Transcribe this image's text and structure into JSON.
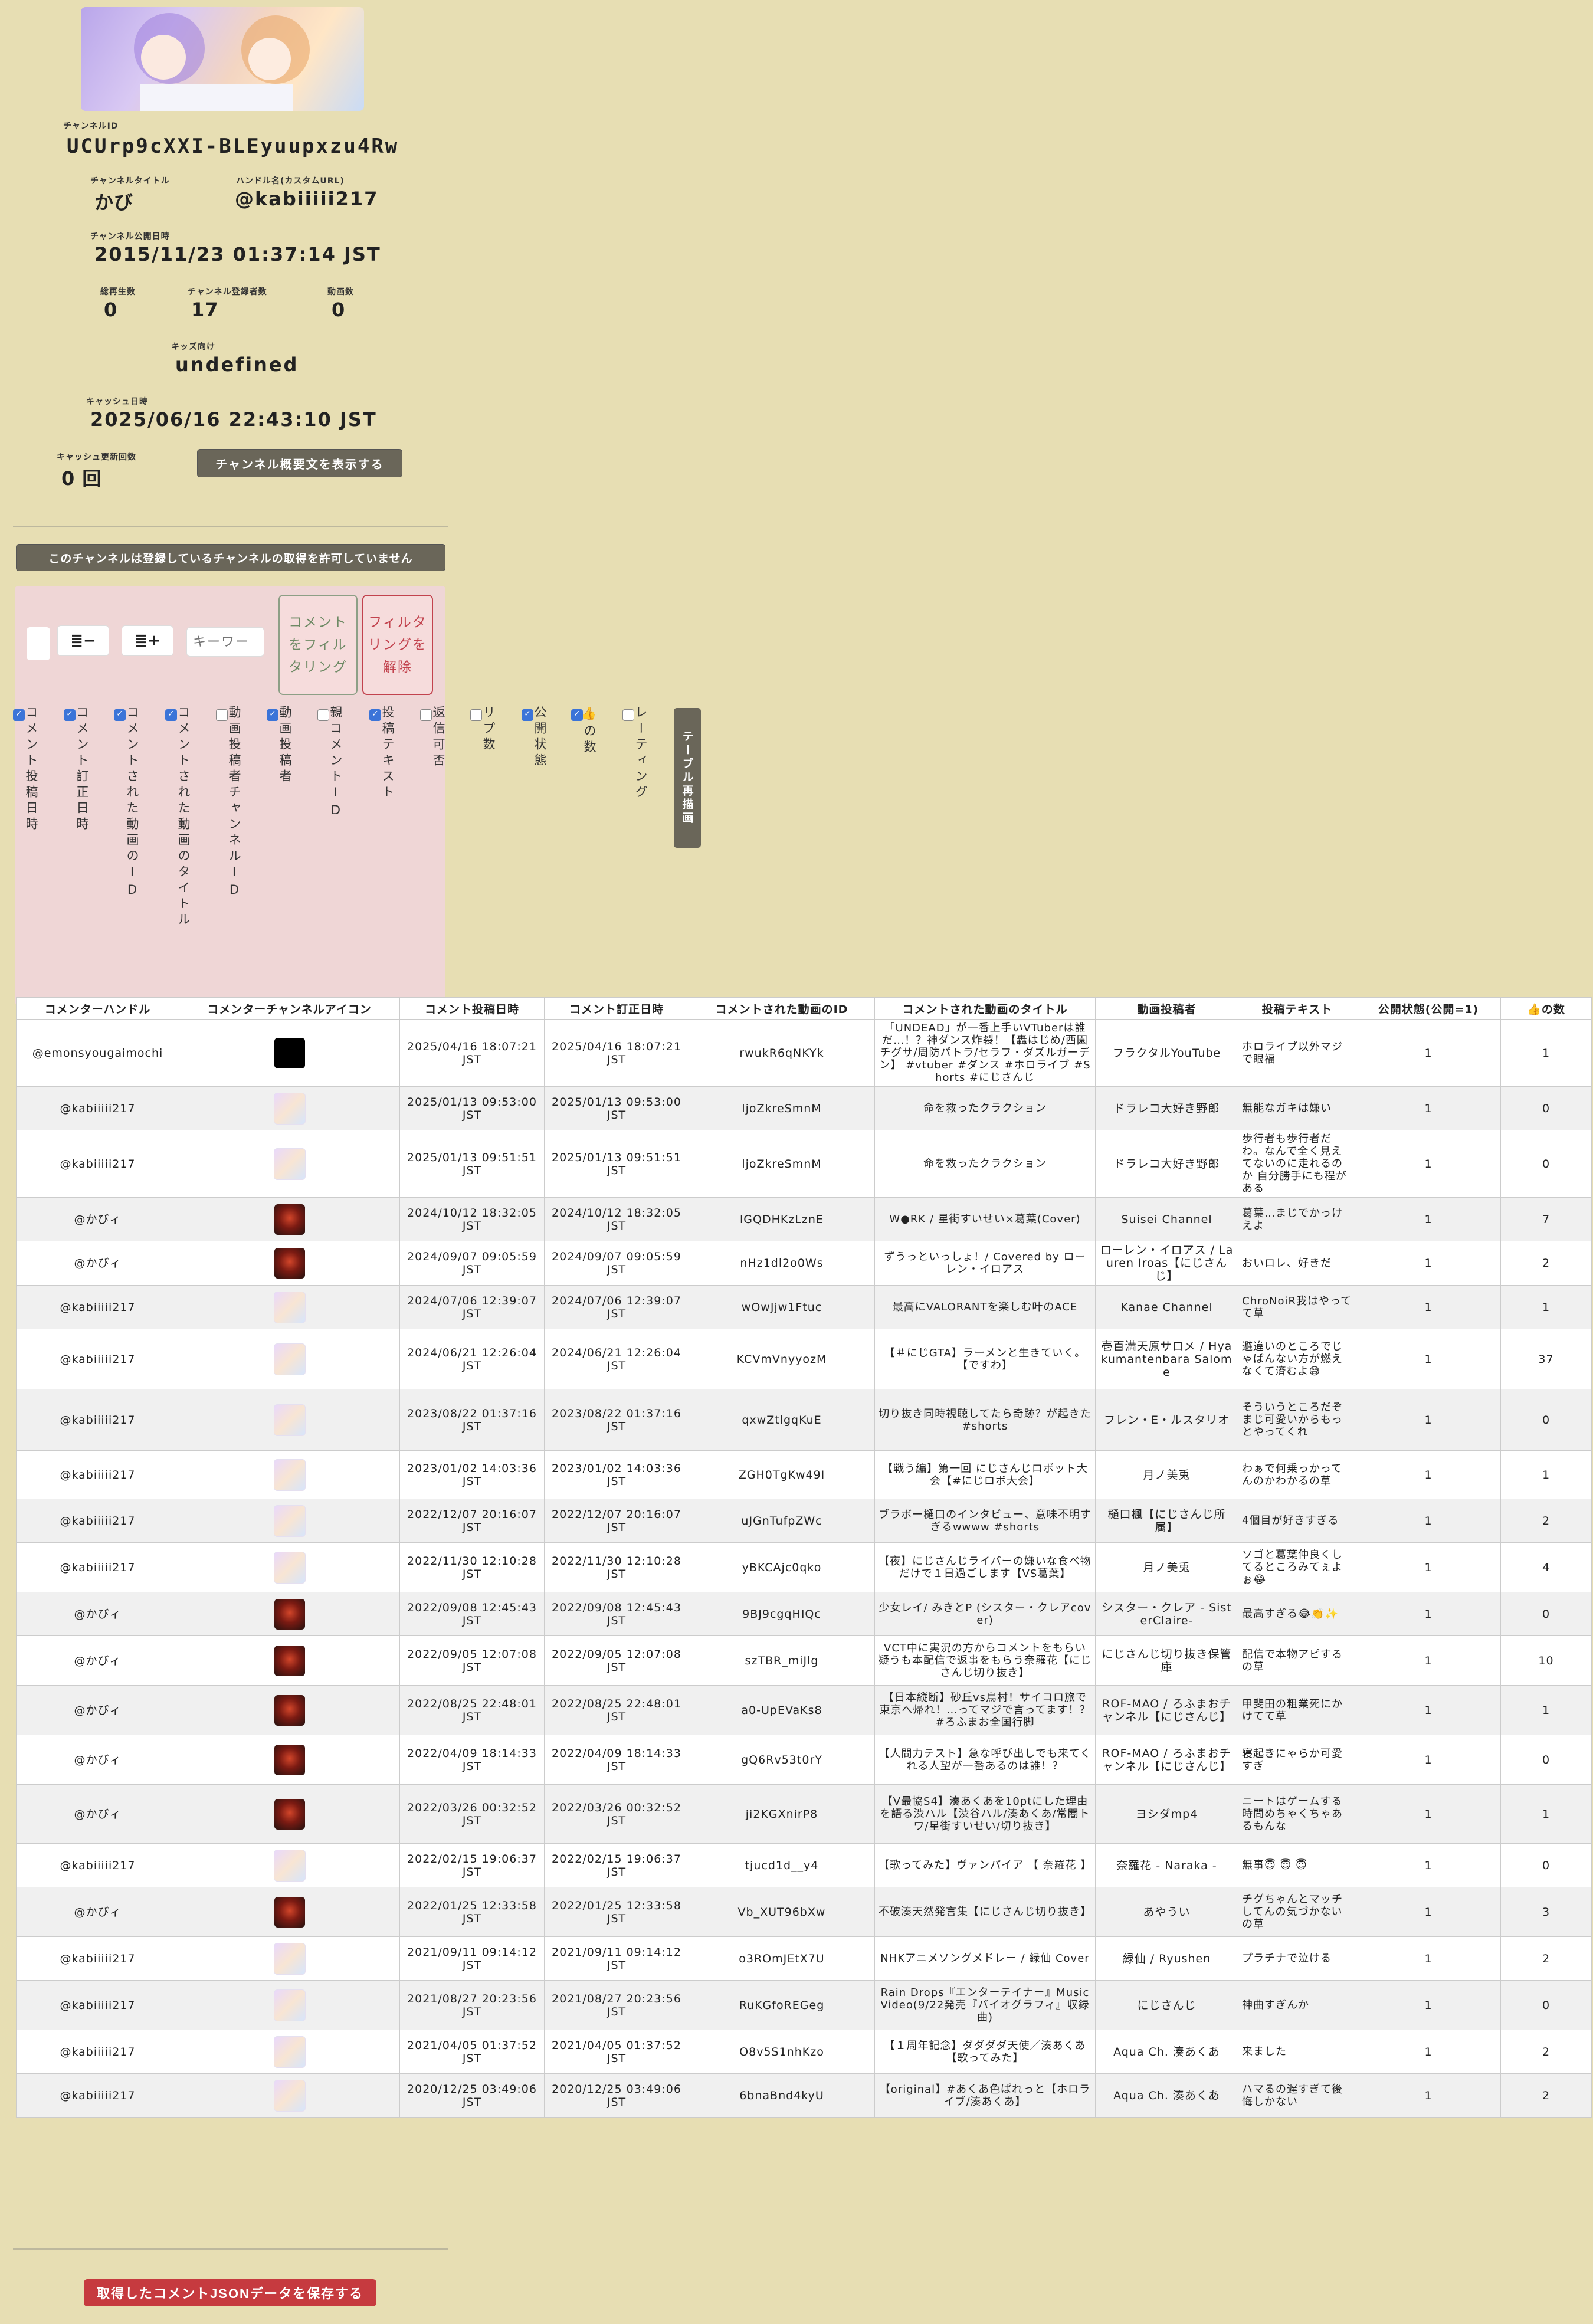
{
  "channel": {
    "id_label": "チャンネルID",
    "id": "UCUrp9cXXI-BLEyuupxzu4Rw",
    "title_label": "チャンネルタイトル",
    "title": "かび",
    "handle_label": "ハンドル名(カスタムURL)",
    "handle": "@kabiiiii217",
    "published_label": "チャンネル公開日時",
    "published": "2015/11/23 01:37:14 JST",
    "views_label": "総再生数",
    "views": "0",
    "subs_label": "チャンネル登録者数",
    "subs": "17",
    "videos_label": "動画数",
    "videos": "0",
    "kids_label": "キッズ向け",
    "kids": "undefined",
    "cache_label": "キャッシュ日時",
    "cache": "2025/06/16 22:43:10 JST",
    "cache_count_label": "キャッシュ更新回数",
    "cache_count": "0 回",
    "show_desc_button": "チャンネル概要文を表示する"
  },
  "notice_button": "このチャンネルは登録しているチャンネルの取得を許可していません",
  "filter": {
    "keyword_placeholder": "キーワー",
    "filter_button": "コメントをフィルタリング",
    "clear_button": "フィルタリングを解除",
    "redraw_button": "テーブル再描画",
    "columns": [
      {
        "label": "コメント投稿日時",
        "checked": true
      },
      {
        "label": "コメント訂正日時",
        "checked": true
      },
      {
        "label": "コメントされた動画のID",
        "checked": true
      },
      {
        "label": "コメントされた動画のタイトル",
        "checked": true
      },
      {
        "label": "動画投稿者チャンネルID",
        "checked": false
      },
      {
        "label": "動画投稿者",
        "checked": true
      },
      {
        "label": "親コメントID",
        "checked": false
      },
      {
        "label": "投稿テキスト",
        "checked": true
      },
      {
        "label": "返信可否",
        "checked": false
      },
      {
        "label": "リプ数",
        "checked": false
      },
      {
        "label": "公開状態",
        "checked": true
      },
      {
        "label": "👍の数",
        "checked": true
      },
      {
        "label": "レーティング",
        "checked": false
      }
    ]
  },
  "table": {
    "headers": [
      "コメンターハンドル",
      "コメンターチャンネルアイコン",
      "コメント投稿日時",
      "コメント訂正日時",
      "コメントされた動画のID",
      "コメントされた動画のタイトル",
      "動画投稿者",
      "投稿テキスト",
      "公開状態(公開=1)",
      "👍の数"
    ],
    "rows": [
      {
        "handle": "@emonsyougaimochi",
        "icon": "black",
        "posted": "2025/04/16 18:07:21 JST",
        "edited": "2025/04/16 18:07:21 JST",
        "vid": "rwukR6qNKYk",
        "title": "「UNDEAD」が一番上手いVTuberは誰だ…！？神ダンス炸裂！【轟はじめ/西園チグサ/周防パトラ/セラフ・ダズルガーデン】 #vtuber #ダンス #ホロライブ #Shorts #にじさんじ",
        "uploader": "フラクタルYouTube",
        "text": "ホロライブ以外マジで眼福",
        "public": "1",
        "likes": "1"
      },
      {
        "handle": "@kabiiiii217",
        "icon": "anime",
        "posted": "2025/01/13 09:53:00 JST",
        "edited": "2025/01/13 09:53:00 JST",
        "vid": "ljoZkreSmnM",
        "title": "命を救ったクラクション",
        "uploader": "ドラレコ大好き野郎",
        "text": "無能なガキは嫌い",
        "public": "1",
        "likes": "0"
      },
      {
        "handle": "@kabiiiii217",
        "icon": "anime",
        "posted": "2025/01/13 09:51:51 JST",
        "edited": "2025/01/13 09:51:51 JST",
        "vid": "ljoZkreSmnM",
        "title": "命を救ったクラクション",
        "uploader": "ドラレコ大好き野郎",
        "text": "歩行者も歩行者だわ。なんで全く見えてないのに走れるのか 自分勝手にも程がある",
        "public": "1",
        "likes": "0"
      },
      {
        "handle": "@かびィ",
        "icon": "red",
        "posted": "2024/10/12 18:32:05 JST",
        "edited": "2024/10/12 18:32:05 JST",
        "vid": "lGQDHKzLznE",
        "title": "W●RK / 星街すいせい×葛葉(Cover)",
        "uploader": "Suisei Channel",
        "text": "葛葉…まじでかっけえよ",
        "public": "1",
        "likes": "7"
      },
      {
        "handle": "@かびィ",
        "icon": "red",
        "posted": "2024/09/07 09:05:59 JST",
        "edited": "2024/09/07 09:05:59 JST",
        "vid": "nHz1dl2o0Ws",
        "title": "ずうっといっしょ！/ Covered by ローレン・イロアス",
        "uploader": "ローレン・イロアス / Lauren Iroas【にじさんじ】",
        "text": "おいロレ、好きだ",
        "public": "1",
        "likes": "2"
      },
      {
        "handle": "@kabiiiii217",
        "icon": "anime",
        "posted": "2024/07/06 12:39:07 JST",
        "edited": "2024/07/06 12:39:07 JST",
        "vid": "wOwJjw1Ftuc",
        "title": "最高にVALORANTを楽しむ叶のACE",
        "uploader": "Kanae Channel",
        "text": "ChroNoiR我はやってて草",
        "public": "1",
        "likes": "1"
      },
      {
        "handle": "@kabiiiii217",
        "icon": "anime",
        "posted": "2024/06/21 12:26:04 JST",
        "edited": "2024/06/21 12:26:04 JST",
        "vid": "KCVmVnyyozM",
        "title": "【＃にじGTA】ラーメンと生きていく。【ですわ】",
        "uploader": "壱百満天原サロメ / Hyakumantenbara Salome",
        "text": "避違いのところでじゃばんない方が燃えなくて済むよ😅",
        "public": "1",
        "likes": "37"
      },
      {
        "handle": "@kabiiiii217",
        "icon": "anime",
        "posted": "2023/08/22 01:37:16 JST",
        "edited": "2023/08/22 01:37:16 JST",
        "vid": "qxwZtlgqKuE",
        "title": "切り抜き同時視聴してたら奇跡？が起きた #shorts",
        "uploader": "フレン・E・ルスタリオ",
        "text": "そういうところだぞ まじ可愛いからもっとやってくれ",
        "public": "1",
        "likes": "0"
      },
      {
        "handle": "@kabiiiii217",
        "icon": "anime",
        "posted": "2023/01/02 14:03:36 JST",
        "edited": "2023/01/02 14:03:36 JST",
        "vid": "ZGH0TgKw49I",
        "title": "【戦う編】第一回 にじさんじロボット大会【#にじロボ大会】",
        "uploader": "月ノ美兎",
        "text": "わぁで何乗っかってんのかわかるの草",
        "public": "1",
        "likes": "1"
      },
      {
        "handle": "@kabiiiii217",
        "icon": "anime",
        "posted": "2022/12/07 20:16:07 JST",
        "edited": "2022/12/07 20:16:07 JST",
        "vid": "uJGnTufpZWc",
        "title": "ブラボー樋口のインタビュー、意味不明すぎるwwww #shorts",
        "uploader": "樋口楓【にじさんじ所属】",
        "text": "4個目が好きすぎる",
        "public": "1",
        "likes": "2"
      },
      {
        "handle": "@kabiiiii217",
        "icon": "anime",
        "posted": "2022/11/30 12:10:28 JST",
        "edited": "2022/11/30 12:10:28 JST",
        "vid": "yBKCAjc0qko",
        "title": "【夜】にじさんじライバーの嫌いな食べ物だけで１日過ごします【VS葛葉】",
        "uploader": "月ノ美兎",
        "text": "ソゴと葛葉仲良くしてるところみてぇよぉ😂",
        "public": "1",
        "likes": "4"
      },
      {
        "handle": "@かびィ",
        "icon": "red",
        "posted": "2022/09/08 12:45:43 JST",
        "edited": "2022/09/08 12:45:43 JST",
        "vid": "9BJ9cgqHIQc",
        "title": "少女レイ/ みきとP (シスター・クレアcover)",
        "uploader": "シスター・クレア - SisterClaire-",
        "text": "最高すぎる😂👏✨",
        "public": "1",
        "likes": "0"
      },
      {
        "handle": "@かびィ",
        "icon": "red",
        "posted": "2022/09/05 12:07:08 JST",
        "edited": "2022/09/05 12:07:08 JST",
        "vid": "szTBR_miJlg",
        "title": "VCT中に実況の方からコメントをもらい疑うも本配信で返事をもらう奈羅花【にじさんじ切り抜き】",
        "uploader": "にじさんじ切り抜き保管庫",
        "text": "配信で本物アピするの草",
        "public": "1",
        "likes": "10"
      },
      {
        "handle": "@かびィ",
        "icon": "red",
        "posted": "2022/08/25 22:48:01 JST",
        "edited": "2022/08/25 22:48:01 JST",
        "vid": "a0-UpEVaKs8",
        "title": "【日本縦断】砂丘vs鳥村！サイコロ旅で東京へ帰れ！…ってマジで言ってます！？ #ろふまお全国行脚",
        "uploader": "ROF-MAO / ろふまおチャンネル【にじさんじ】",
        "text": "甲斐田の粗業死にかけてて草",
        "public": "1",
        "likes": "1"
      },
      {
        "handle": "@かびィ",
        "icon": "red",
        "posted": "2022/04/09 18:14:33 JST",
        "edited": "2022/04/09 18:14:33 JST",
        "vid": "gQ6Rv53t0rY",
        "title": "【人間力テスト】急な呼び出しでも来てくれる人望が一番あるのは誰！？",
        "uploader": "ROF-MAO / ろふまおチャンネル【にじさんじ】",
        "text": "寝起きにゃらか可愛すぎ",
        "public": "1",
        "likes": "0"
      },
      {
        "handle": "@かびィ",
        "icon": "red",
        "posted": "2022/03/26 00:32:52 JST",
        "edited": "2022/03/26 00:32:52 JST",
        "vid": "ji2KGXnirP8",
        "title": "【V最協S4】湊あくあを10ptにした理由を語る渋ハル【渋谷ハル/湊あくあ/常闇トワ/星街すいせい/切り抜き】",
        "uploader": "ヨシダmp4",
        "text": "ニートはゲームする時間めちゃくちゃあるもんな",
        "public": "1",
        "likes": "1"
      },
      {
        "handle": "@kabiiiii217",
        "icon": "anime",
        "posted": "2022/02/15 19:06:37 JST",
        "edited": "2022/02/15 19:06:37 JST",
        "vid": "tjucd1d__y4",
        "title": "【歌ってみた】ヴァンパイア 【 奈羅花 】",
        "uploader": "奈羅花 - Naraka -",
        "text": "無事😇 😇 😇",
        "public": "1",
        "likes": "0"
      },
      {
        "handle": "@かびィ",
        "icon": "red",
        "posted": "2022/01/25 12:33:58 JST",
        "edited": "2022/01/25 12:33:58 JST",
        "vid": "Vb_XUT96bXw",
        "title": "不破湊天然発言集【にじさんじ切り抜き】",
        "uploader": "あやうい",
        "text": "チグちゃんとマッチしてんの気づかないの草",
        "public": "1",
        "likes": "3"
      },
      {
        "handle": "@kabiiiii217",
        "icon": "anime",
        "posted": "2021/09/11 09:14:12 JST",
        "edited": "2021/09/11 09:14:12 JST",
        "vid": "o3ROmJEtX7U",
        "title": "NHKアニメソングメドレー / 緑仙 Cover",
        "uploader": "緑仙 / Ryushen",
        "text": "プラチナで泣ける",
        "public": "1",
        "likes": "2"
      },
      {
        "handle": "@kabiiiii217",
        "icon": "anime",
        "posted": "2021/08/27 20:23:56 JST",
        "edited": "2021/08/27 20:23:56 JST",
        "vid": "RuKGfoREGeg",
        "title": "Rain Drops『エンターテイナー』Music Video(9/22発売『バイオグラフィ』収録曲)",
        "uploader": "にじさんじ",
        "text": "神曲すぎんか",
        "public": "1",
        "likes": "0"
      },
      {
        "handle": "@kabiiiii217",
        "icon": "anime",
        "posted": "2021/04/05 01:37:52 JST",
        "edited": "2021/04/05 01:37:52 JST",
        "vid": "O8v5S1nhKzo",
        "title": "【１周年記念】ダダダダ天使／湊あくあ【歌ってみた】",
        "uploader": "Aqua Ch. 湊あくあ",
        "text": "来ました",
        "public": "1",
        "likes": "2"
      },
      {
        "handle": "@kabiiiii217",
        "icon": "anime",
        "posted": "2020/12/25 03:49:06 JST",
        "edited": "2020/12/25 03:49:06 JST",
        "vid": "6bnaBnd4kyU",
        "title": "【original】#あくあ色ぱれっと【ホロライブ/湊あくあ】",
        "uploader": "Aqua Ch. 湊あくあ",
        "text": "ハマるの遅すぎて後悔しかない",
        "public": "1",
        "likes": "2"
      }
    ]
  },
  "save_button": "取得したコメントJSONデータを保存する"
}
